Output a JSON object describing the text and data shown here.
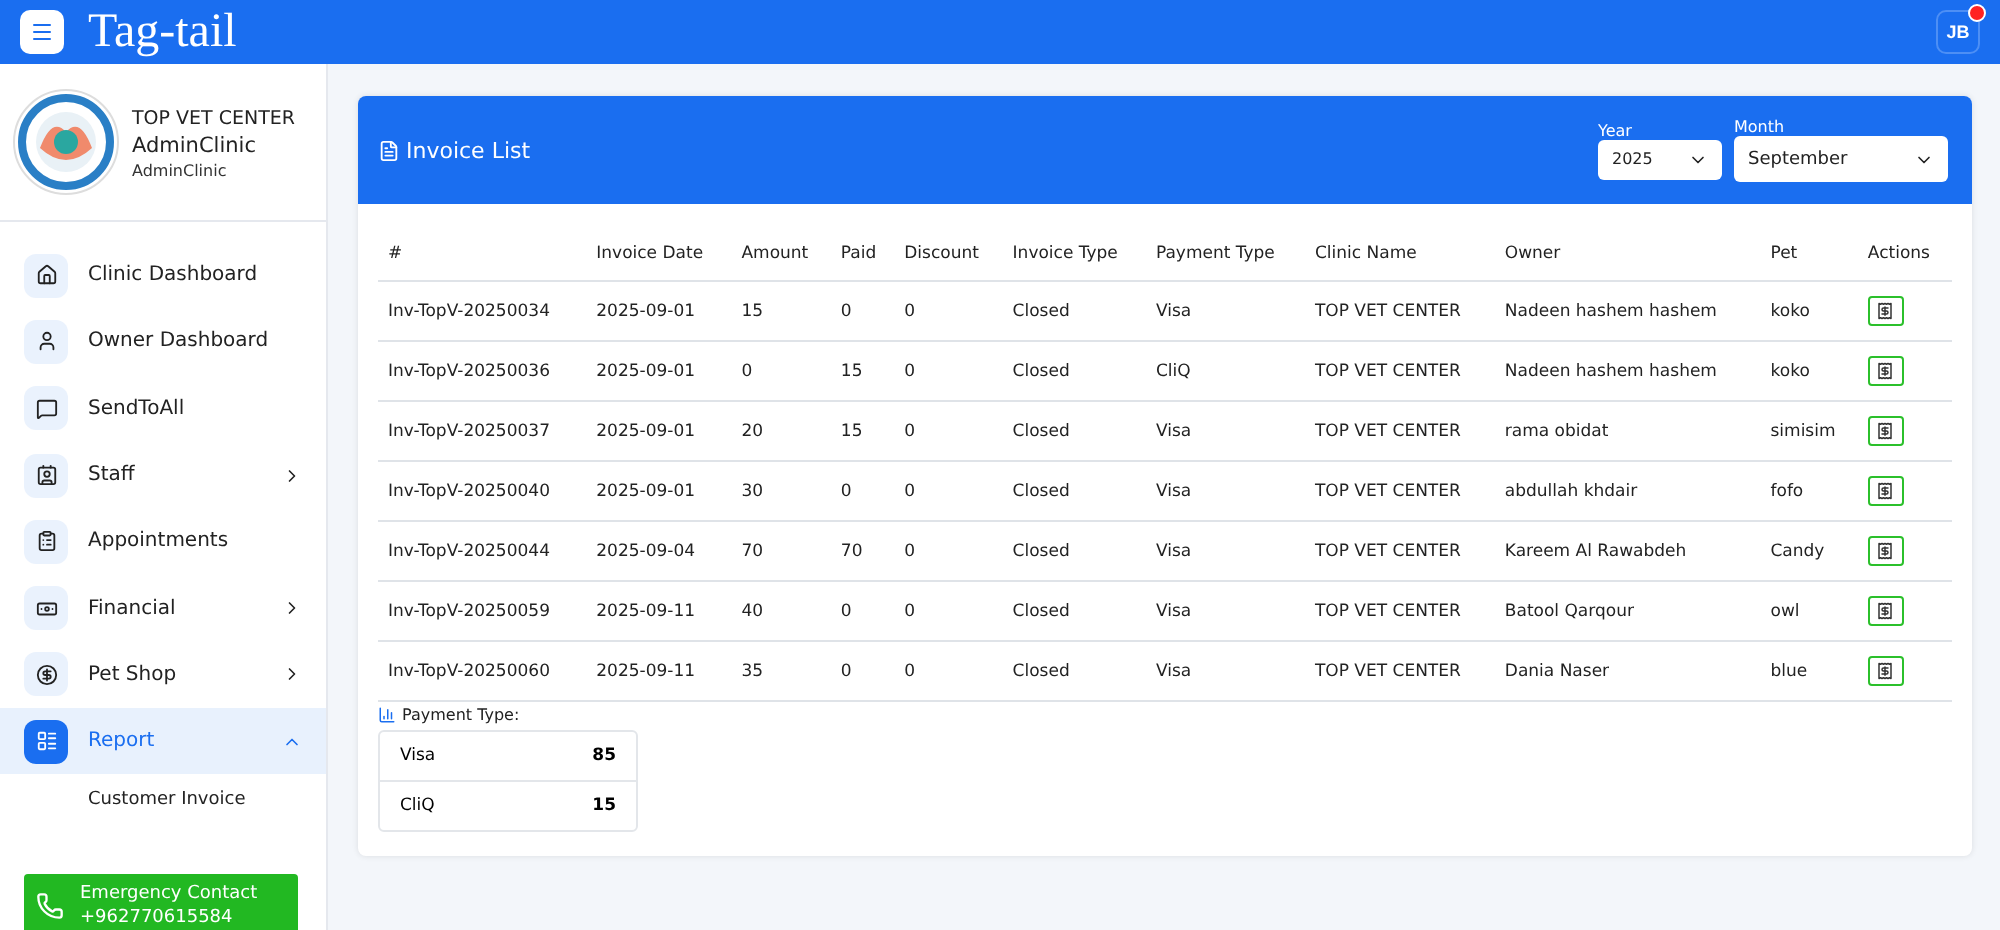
{
  "topbar": {
    "brand": "Tag-tail",
    "avatar": "JB",
    "notification": true
  },
  "profile": {
    "clinic": "TOP VET CENTER",
    "role": "AdminClinic",
    "user": "AdminClinic"
  },
  "menu": [
    {
      "label": "Clinic Dashboard",
      "kind": "link",
      "selected": false
    },
    {
      "label": "Owner Dashboard",
      "kind": "link",
      "selected": false
    },
    {
      "label": "SendToAll",
      "kind": "link",
      "selected": false
    },
    {
      "label": "Staff",
      "kind": "group",
      "expanded": false,
      "selected": false
    },
    {
      "label": "Appointments",
      "kind": "link",
      "selected": false
    },
    {
      "label": "Financial",
      "kind": "group",
      "expanded": false,
      "selected": false
    },
    {
      "label": "Pet Shop",
      "kind": "group",
      "expanded": false,
      "selected": false
    },
    {
      "label": "Report",
      "kind": "group",
      "expanded": true,
      "selected": true,
      "children": [
        {
          "label": "Customer Invoice"
        }
      ]
    }
  ],
  "emergency": {
    "title": "Emergency Contact",
    "phone": "+962770615584"
  },
  "card": {
    "title": "Invoice List",
    "year": {
      "label": "Year",
      "value": "2025"
    },
    "month": {
      "label": "Month",
      "value": "September"
    }
  },
  "table": {
    "columns": [
      "#",
      "Invoice Date",
      "Amount",
      "Paid",
      "Discount",
      "Invoice Type",
      "Payment Type",
      "Clinic Name",
      "Owner",
      "Pet",
      "Actions"
    ],
    "rows": [
      [
        "Inv-TopV-20250034",
        "2025-09-01",
        "15",
        "0",
        "0",
        "Closed",
        "Visa",
        "TOP VET CENTER",
        "Nadeen hashem hashem",
        "koko"
      ],
      [
        "Inv-TopV-20250036",
        "2025-09-01",
        "0",
        "15",
        "0",
        "Closed",
        "CliQ",
        "TOP VET CENTER",
        "Nadeen hashem hashem",
        "koko"
      ],
      [
        "Inv-TopV-20250037",
        "2025-09-01",
        "20",
        "15",
        "0",
        "Closed",
        "Visa",
        "TOP VET CENTER",
        "rama obidat",
        "simisim"
      ],
      [
        "Inv-TopV-20250040",
        "2025-09-01",
        "30",
        "0",
        "0",
        "Closed",
        "Visa",
        "TOP VET CENTER",
        "abdullah khdair",
        "fofo"
      ],
      [
        "Inv-TopV-20250044",
        "2025-09-04",
        "70",
        "70",
        "0",
        "Closed",
        "Visa",
        "TOP VET CENTER",
        "Kareem Al Rawabdeh",
        "Candy"
      ],
      [
        "Inv-TopV-20250059",
        "2025-09-11",
        "40",
        "0",
        "0",
        "Closed",
        "Visa",
        "TOP VET CENTER",
        "Batool Qarqour",
        "owl"
      ],
      [
        "Inv-TopV-20250060",
        "2025-09-11",
        "35",
        "0",
        "0",
        "Closed",
        "Visa",
        "TOP VET CENTER",
        "Dania Naser",
        "blue"
      ]
    ]
  },
  "summary": {
    "title": "Payment Type:",
    "items": [
      {
        "label": "Visa",
        "value": "85"
      },
      {
        "label": "CliQ",
        "value": "15"
      }
    ]
  }
}
